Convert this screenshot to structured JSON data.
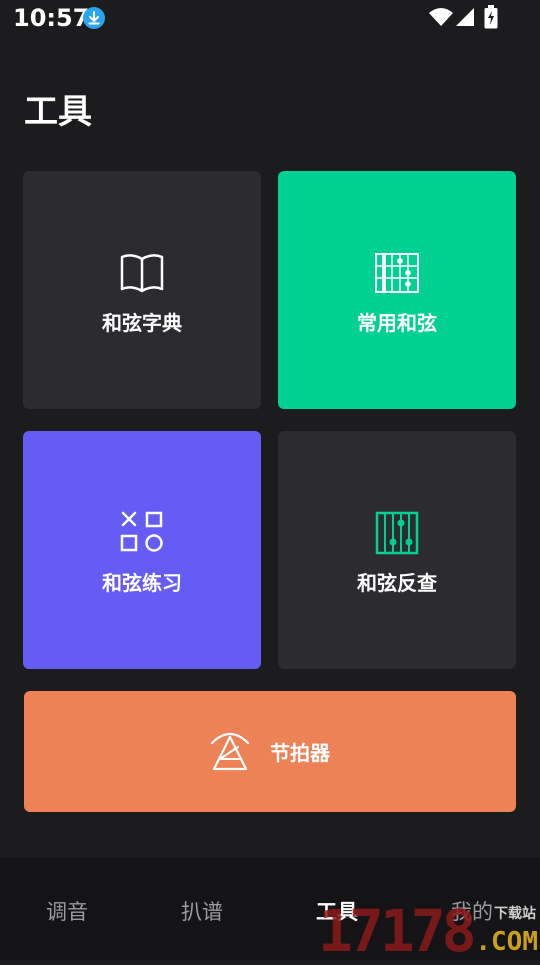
{
  "status_bar": {
    "time": "10:57"
  },
  "page": {
    "title": "工具"
  },
  "tools": {
    "dict": "和弦字典",
    "common": "常用和弦",
    "practice": "和弦练习",
    "reverse": "和弦反查",
    "metronome": "节拍器"
  },
  "bottom_nav": {
    "items": [
      "调音",
      "扒谱",
      "工具",
      "我的"
    ],
    "active": "工具"
  },
  "watermark": {
    "number": "17178",
    "top_text": "下载站",
    "suffix": ".COM"
  },
  "colors": {
    "background": "#1c1c1e",
    "card_dark": "#2c2c30",
    "card_green": "#00d091",
    "card_purple": "#655bf5",
    "card_orange": "#ee8257"
  }
}
